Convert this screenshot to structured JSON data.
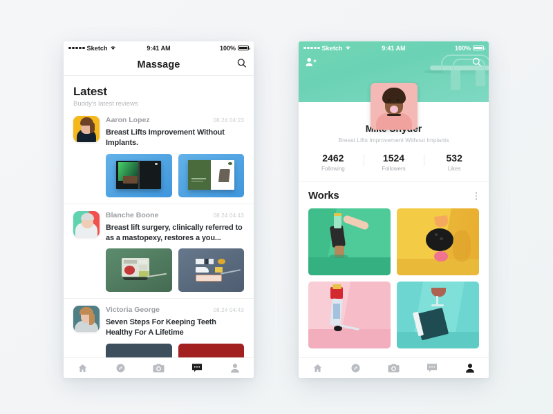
{
  "theme": {
    "page_bg": "#f4f5f7",
    "accent_mint": "#71d6b4",
    "text_dark": "#1d1d1d",
    "text_muted": "#b4b7bb",
    "photo_blue": "#4ba3e3"
  },
  "status_bar": {
    "carrier": "Sketch",
    "wifi_icon": "wifi-icon",
    "time": "9:41 AM",
    "battery_percent": "100%",
    "battery_icon": "battery-full-icon"
  },
  "screen_feed": {
    "nav": {
      "title": "Massage",
      "search_icon": "search-icon"
    },
    "section": {
      "title": "Latest",
      "subtitle": "Buddy's latest reviews"
    },
    "posts": [
      {
        "author": "Aaron Lopez",
        "time": "08.24  04:23",
        "text": "Breast Lifts Improvement Without Implants.",
        "avatar_name": "avatar-aaron-lopez",
        "images": [
          {
            "name": "post-image-open-book-dark",
            "bg": "#4ba3e3"
          },
          {
            "name": "post-image-green-book-chair",
            "bg": "#4ba3e3"
          }
        ]
      },
      {
        "author": "Blanche Boone",
        "time": "08.24  04:43",
        "text": "Breast lift surgery, clinically referred to as a mastopexy, restores a you...",
        "avatar_name": "avatar-blanche-boone",
        "images": [
          {
            "name": "post-image-green-pan",
            "bg": "#4f7e63"
          },
          {
            "name": "post-image-slate-tray",
            "bg": "#5a6b7f"
          }
        ]
      },
      {
        "author": "Victoria George",
        "time": "08.24  04:43",
        "text": "Seven Steps For Keeping Teeth Healthy For A Lifetime",
        "avatar_name": "avatar-victoria-george",
        "images": [
          {
            "name": "post-image-dark-slate",
            "bg": "#3d4f5c"
          },
          {
            "name": "post-image-dark-red",
            "bg": "#a32020"
          }
        ]
      }
    ],
    "tabbar": {
      "active": "messages",
      "items": [
        {
          "id": "home",
          "icon": "home-icon"
        },
        {
          "id": "discover",
          "icon": "compass-icon"
        },
        {
          "id": "camera",
          "icon": "camera-icon"
        },
        {
          "id": "messages",
          "icon": "chat-bubble-icon"
        },
        {
          "id": "profile",
          "icon": "person-icon"
        }
      ]
    }
  },
  "screen_profile": {
    "nav": {
      "add_friend_icon": "add-person-icon",
      "search_icon": "search-icon"
    },
    "cover": {
      "name": "cover-photo-mint-chair",
      "bg": "#71d6b4"
    },
    "avatar_name": "profile-avatar-bubblegum",
    "name": "Mike Snyder",
    "tagline": "Breast Lifts Improvement Without Implants",
    "stats": [
      {
        "value": "2462",
        "label": "Following"
      },
      {
        "value": "1524",
        "label": "Followers"
      },
      {
        "value": "532",
        "label": "Likes"
      }
    ],
    "works": {
      "title": "Works",
      "menu_icon": "kebab-menu-icon",
      "items": [
        {
          "name": "work-green-handstand",
          "bg": "#3fbd8b"
        },
        {
          "name": "work-yellow-bowling",
          "bg": "#f5cf4a"
        },
        {
          "name": "work-pink-legshoe",
          "bg": "#f7c6cf"
        },
        {
          "name": "work-teal-wine-book",
          "bg": "#66d3cf"
        }
      ]
    },
    "tabbar": {
      "active": "profile",
      "items": [
        {
          "id": "home",
          "icon": "home-icon"
        },
        {
          "id": "discover",
          "icon": "compass-icon"
        },
        {
          "id": "camera",
          "icon": "camera-icon"
        },
        {
          "id": "messages",
          "icon": "chat-bubble-icon"
        },
        {
          "id": "profile",
          "icon": "person-icon"
        }
      ]
    }
  }
}
